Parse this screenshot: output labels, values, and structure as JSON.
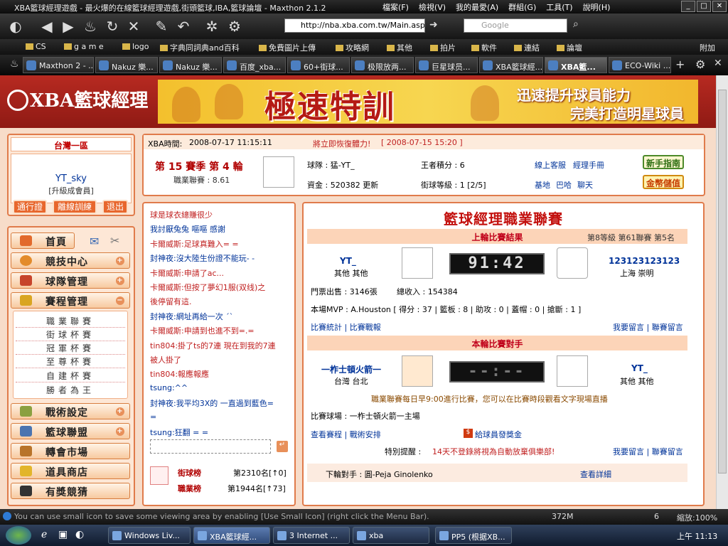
{
  "window": {
    "title": "XBA籃球經理遊戲 - 最火爆的在線籃球經理遊戲,街頭籃球,IBA,籃球論壇 - Maxthon 2.1.2",
    "menu": [
      "檔案(F)",
      "檢視(V)",
      "我的最愛(A)",
      "群組(G)",
      "工具(T)",
      "說明(H)"
    ]
  },
  "address": {
    "url": "http://nba.xba.com.tw/Main.asp",
    "search_placeholder": "Google"
  },
  "favorites": [
    "CS",
    "g a m e",
    "logo",
    "字典同詞典and百科",
    "免費圖片上傳",
    "攻略網",
    "其他",
    "拍片",
    "軟件",
    "連結",
    "論壇"
  ],
  "favorites_more": "附加",
  "tabs": [
    "Maxthon 2 - ...",
    "Nakuz 樂...",
    "Nakuz 樂...",
    "百度_xba...",
    "60+街球...",
    "极限放两...",
    "巨星球员...",
    "XBA籃球經...",
    "XBA籃...",
    "ECO-Wiki ..."
  ],
  "site": {
    "logo": "XBA籃球經理",
    "banner_main": "極速特訓",
    "banner_line1": "迅速提升球員能力",
    "banner_line2": "完美打造明星球員"
  },
  "user": {
    "region": "台灣一區",
    "name": "YT_sky",
    "level": "[升級成會員]",
    "buttons": [
      "通行證",
      "離線訓練",
      "退出"
    ]
  },
  "nav": {
    "home": "首頁",
    "items": [
      "競技中心",
      "球隊管理",
      "賽程管理"
    ],
    "sub_items": [
      "職業聯賽",
      "街球杯賽",
      "冠軍杯賽",
      "至尊杯賽",
      "自建杯賽",
      "勝者為王"
    ],
    "items2": [
      "戰術設定",
      "籃球聯盟",
      "轉會市場",
      "道具商店",
      "有獎競猜"
    ]
  },
  "info": {
    "time_label": "XBA時間:",
    "time": "2008-07-17 11:15:11",
    "restore_label": "將立即恢復體力!",
    "restore_time": "[ 2008-07-15 15:20 ]",
    "season": "第 15 賽季 第 4 輪",
    "league": "職業聯賽 : 8.61",
    "team_label": "球隊 : 猛-YT_",
    "points_label": "王者積分 : 6",
    "service": "線上客服",
    "manual": "經理手冊",
    "newbie_btn": "新手指南",
    "funds_label": "資金 : 520382 更新",
    "street_label": "街球等級 : 1 [2/5]",
    "links": [
      "基地",
      "巴哈",
      "聊天"
    ],
    "gold_btn": "金幣儲值"
  },
  "chat": [
    {
      "text": "球是球衣總賺很少",
      "color": "red"
    },
    {
      "text": "我討厭兔兔 嘔嘔 感謝",
      "color": "blue"
    },
    {
      "text": "卡爾威斯:足球真難入= =",
      "color": "red"
    },
    {
      "text": "封神夜:沒大陸生份證不能玩- -",
      "color": "blue"
    },
    {
      "text": "卡爾威斯:申請了ac...",
      "color": "red"
    },
    {
      "text": "卡爾威斯:但按了夢幻1服(双线)之",
      "color": "red"
    },
    {
      "text": "後停留有這.",
      "color": "red"
    },
    {
      "text": "封神夜:網址再給一次 ˊˋ",
      "color": "blue"
    },
    {
      "text": "卡爾威斯:申請到也進不到=.=",
      "color": "red"
    },
    {
      "text": "tin804:掛了ts的7連 現在到我的7連",
      "color": "red"
    },
    {
      "text": "被人掛了",
      "color": "red"
    },
    {
      "text": "tin804:報應報應",
      "color": "red"
    },
    {
      "text": "tsung:^^",
      "color": "blue"
    },
    {
      "text": "封神夜:我平均3X的 一直過到藍色=",
      "color": "blue"
    },
    {
      "text": "=",
      "color": "blue"
    },
    {
      "text": "tsung:狂翻 = =",
      "color": "blue"
    }
  ],
  "rank": {
    "street_label": "街球榜",
    "street_val": "第2310名[↑0]",
    "pro_label": "職業榜",
    "pro_val": "第1944名[↑73]"
  },
  "league_panel": {
    "title": "籃球經理職業聯賽",
    "last_title": "上輪比賽結果",
    "last_rank": "第8等級 第61聯賽 第5名",
    "home_name": "YT_",
    "home_loc": "其他 其他",
    "score": "91:42",
    "away_name": "123123123123",
    "away_loc": "上海 崇明",
    "tickets": "門票出售 : 3146張",
    "income": "總收入 : 154384",
    "mvp": "本場MVP : A.Houston [ 得分 : 37 | 籃板 : 8 | 助攻 : 0 | 蓋帽 : 0 | 搶斷 : 1 ]",
    "links_left": "比賽統計 | 比賽戰報",
    "links_right": "我要留言 | 聯賽留言",
    "next_title": "本輪比賽對手",
    "next_home": "一柞士頓火箭一",
    "next_home_loc": "台灣 台北",
    "next_score": "--:--",
    "next_away": "YT_",
    "next_away_loc": "其他 其他",
    "notice": "職業聯賽每日早9:00進行比賽，您可以在比賽時段觀看文字現場直播",
    "venue": "比賽球場 : 一柞士頓火箭一主場",
    "links2": "查看賽程 | 戰術安排",
    "bonus": "給球員發獎金",
    "warn_label": "特別提醒 :",
    "warn": "14天不登錄將視為自動放棄俱樂部!",
    "links3": "我要留言 | 聯賽留言",
    "next_opp": "下輪對手 : 圓-Peja Ginolenko",
    "detail": "查看詳細"
  },
  "status": {
    "tip": "You can use small icon to save some viewing area by enabling [Use Small Icon] (right click the Menu Bar).",
    "mem": "372M",
    "zoom": "縮放:100%",
    "num": "6"
  },
  "taskbar": {
    "items": [
      "Windows Liv...",
      "XBA籃球經...",
      "3 Internet ...",
      "xba",
      "PP5 (根据XB..."
    ],
    "time": "上午 11:13"
  }
}
